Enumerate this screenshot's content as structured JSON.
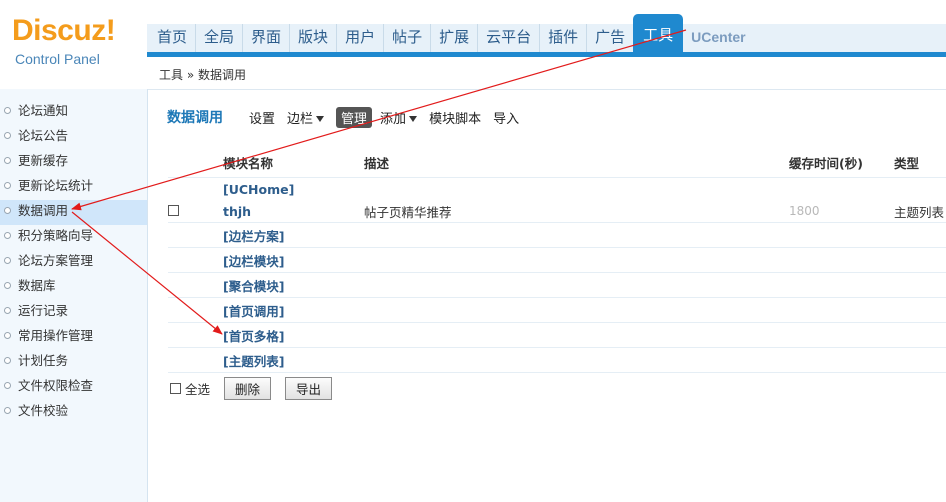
{
  "logo": {
    "main": "Discuz!",
    "sub": "Control Panel"
  },
  "top_nav": [
    {
      "label": "首页"
    },
    {
      "label": "全局"
    },
    {
      "label": "界面"
    },
    {
      "label": "版块"
    },
    {
      "label": "用户"
    },
    {
      "label": "帖子"
    },
    {
      "label": "扩展"
    },
    {
      "label": "云平台"
    },
    {
      "label": "插件"
    },
    {
      "label": "广告"
    },
    {
      "label": "工具",
      "active": true
    },
    {
      "label": "UCenter"
    }
  ],
  "breadcrumb": "工具 » 数据调用",
  "sidebar": [
    {
      "label": "论坛通知"
    },
    {
      "label": "论坛公告"
    },
    {
      "label": "更新缓存"
    },
    {
      "label": "更新论坛统计"
    },
    {
      "label": "数据调用",
      "active": true
    },
    {
      "label": "积分策略向导"
    },
    {
      "label": "论坛方案管理"
    },
    {
      "label": "数据库"
    },
    {
      "label": "运行记录"
    },
    {
      "label": "常用操作管理"
    },
    {
      "label": "计划任务"
    },
    {
      "label": "文件权限检查"
    },
    {
      "label": "文件校验"
    }
  ],
  "tabs": {
    "title": "数据调用",
    "items": [
      {
        "label": "设置"
      },
      {
        "label": "边栏",
        "dropdown": true
      },
      {
        "label": "管理",
        "active": true
      },
      {
        "label": "添加",
        "dropdown": true
      },
      {
        "label": "模块脚本"
      },
      {
        "label": "导入"
      }
    ]
  },
  "table": {
    "headers": {
      "name": "模块名称",
      "desc": "描述",
      "cache": "缓存时间(秒)",
      "type": "类型"
    },
    "group_uchome": "[UCHome]",
    "thjh": {
      "name": "thjh",
      "desc": "帖子页精华推荐",
      "cache": "1800",
      "type": "主题列表"
    },
    "groups": [
      "[边栏方案]",
      "[边栏模块]",
      "[聚合模块]",
      "[首页调用]",
      "[首页多格]",
      "[主题列表]"
    ]
  },
  "footer": {
    "select_all": "全选",
    "delete": "删除",
    "export": "导出"
  },
  "colors": {
    "accent": "#1f89cf",
    "arrow": "#e21b1b",
    "logo": "#f49c1c"
  }
}
